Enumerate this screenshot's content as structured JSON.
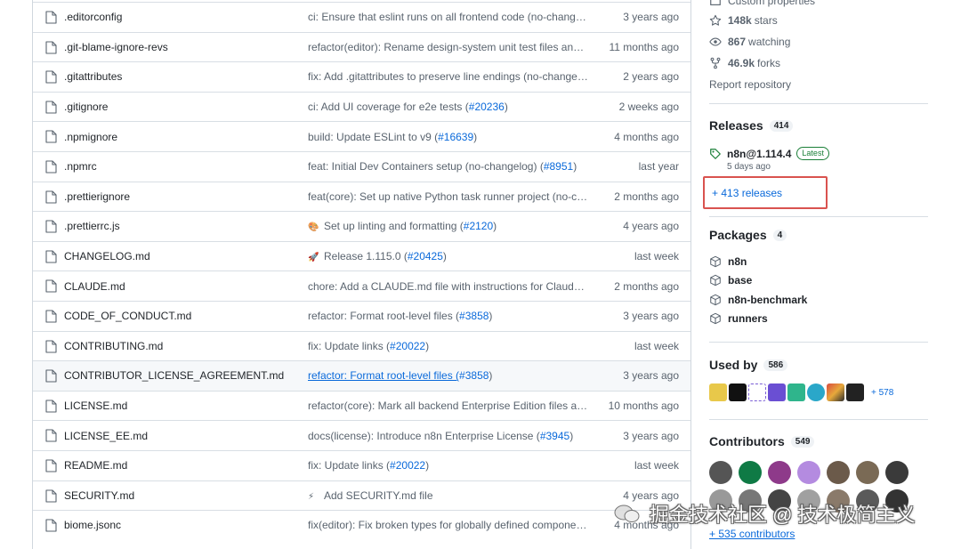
{
  "files": [
    {
      "name": ".editorconfig",
      "msg": "ci: Ensure that eslint runs on all frontend code (no-changelo...",
      "age": "3 years ago"
    },
    {
      "name": ".git-blame-ignore-revs",
      "msg": "refactor(editor): Rename design-system unit test files and sn...",
      "age": "11 months ago"
    },
    {
      "name": ".gitattributes",
      "msg": "fix: Add .gitattributes to preserve line endings (no-changelo...",
      "age": "2 years ago"
    },
    {
      "name": ".gitignore",
      "msg": "ci: Add UI coverage for e2e tests (",
      "pr": "#20236",
      "tail": ")",
      "age": "2 weeks ago"
    },
    {
      "name": ".npmignore",
      "msg": "build: Update ESLint to v9 (",
      "pr": "#16639",
      "tail": ")",
      "age": "4 months ago"
    },
    {
      "name": ".npmrc",
      "msg": "feat: Initial Dev Containers setup (no-changelog) (",
      "pr": "#8951",
      "tail": ")",
      "age": "last year"
    },
    {
      "name": ".prettierignore",
      "msg": "feat(core): Set up native Python task runner project (no-chan...",
      "age": "2 months ago"
    },
    {
      "name": ".prettierrc.js",
      "emoji": "🎨",
      "msg": "Set up linting and formatting (",
      "pr": "#2120",
      "tail": ")",
      "age": "4 years ago"
    },
    {
      "name": "CHANGELOG.md",
      "emoji": "🚀",
      "msg": "Release 1.115.0 (",
      "pr": "#20425",
      "tail": ")",
      "age": "last week"
    },
    {
      "name": "CLAUDE.md",
      "msg": "chore: Add a CLAUDE.md file with instructions for Claude Co...",
      "age": "2 months ago"
    },
    {
      "name": "CODE_OF_CONDUCT.md",
      "msg": "refactor: Format root-level files (",
      "pr": "#3858",
      "tail": ")",
      "age": "3 years ago"
    },
    {
      "name": "CONTRIBUTING.md",
      "msg": "fix: Update links (",
      "pr": "#20022",
      "tail": ")",
      "age": "last week"
    },
    {
      "name": "CONTRIBUTOR_LICENSE_AGREEMENT.md",
      "msg": "refactor: Format root-level files (",
      "pr": "#3858",
      "tail": ")",
      "age": "3 years ago",
      "hover": true
    },
    {
      "name": "LICENSE.md",
      "msg": "refactor(core): Mark all backend Enterprise Edition files and ...",
      "age": "10 months ago"
    },
    {
      "name": "LICENSE_EE.md",
      "msg": "docs(license): Introduce n8n Enterprise License (",
      "pr": "#3945",
      "tail": ")",
      "age": "3 years ago"
    },
    {
      "name": "README.md",
      "msg": "fix: Update links (",
      "pr": "#20022",
      "tail": ")",
      "age": "last week"
    },
    {
      "name": "SECURITY.md",
      "emoji": "⚡",
      "msg": "Add SECURITY.md file",
      "age": "4 years ago"
    },
    {
      "name": "biome.jsonc",
      "msg": "fix(editor): Fix broken types for globally defined components...",
      "age": "4 months ago"
    }
  ],
  "sidebar": {
    "custom_props": "Custom properties",
    "stars": "148k",
    "stars_label": "stars",
    "watching": "867",
    "watching_label": "watching",
    "forks": "46.9k",
    "forks_label": "forks",
    "report": "Report repository",
    "releases_title": "Releases",
    "releases_count": "414",
    "release_name": "n8n@1.114.4",
    "release_badge": "Latest",
    "release_date": "5 days ago",
    "more_releases": "+ 413 releases",
    "packages_title": "Packages",
    "packages_count": "4",
    "packages": [
      "n8n",
      "base",
      "n8n-benchmark",
      "runners"
    ],
    "usedby_title": "Used by",
    "usedby_count": "586",
    "usedby_more": "+ 578",
    "contributors_title": "Contributors",
    "contributors_count": "549",
    "more_contributors": "+ 535 contributors"
  },
  "colors": {
    "link": "#0969da",
    "muted": "#59636e",
    "highlight_box": "#d9534f",
    "latest": "#1a7f37"
  },
  "watermark": "掘金技术社区 @ 技术极简主义"
}
